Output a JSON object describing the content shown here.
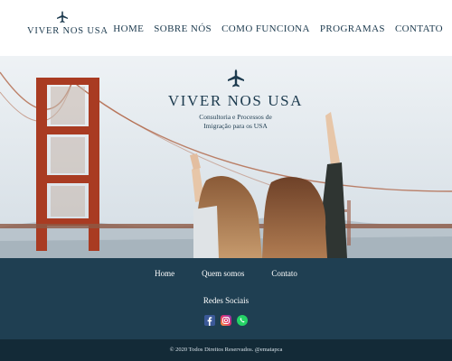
{
  "header": {
    "logo_text": "VIVER NOS USA",
    "nav": [
      "HOME",
      "SOBRE NÓS",
      "COMO FUNCIONA",
      "PROGRAMAS",
      "CONTATO"
    ]
  },
  "hero": {
    "title": "VIVER NOS USA",
    "subtitle": "Consultoria e Processos de Imigração para os USA"
  },
  "footer": {
    "links": [
      "Home",
      "Quem somos",
      "Contato"
    ],
    "social_title": "Redes Sociais",
    "social_icons": [
      "facebook-icon",
      "instagram-icon",
      "whatsapp-icon"
    ],
    "copyright": "© 2020 Todos Direitos Reservados. @ematapca"
  },
  "colors": {
    "brand": "#1c3a4e",
    "footer_bg": "#1f3f52",
    "bottom_bar": "#132a37",
    "bridge": "#b03a22"
  }
}
